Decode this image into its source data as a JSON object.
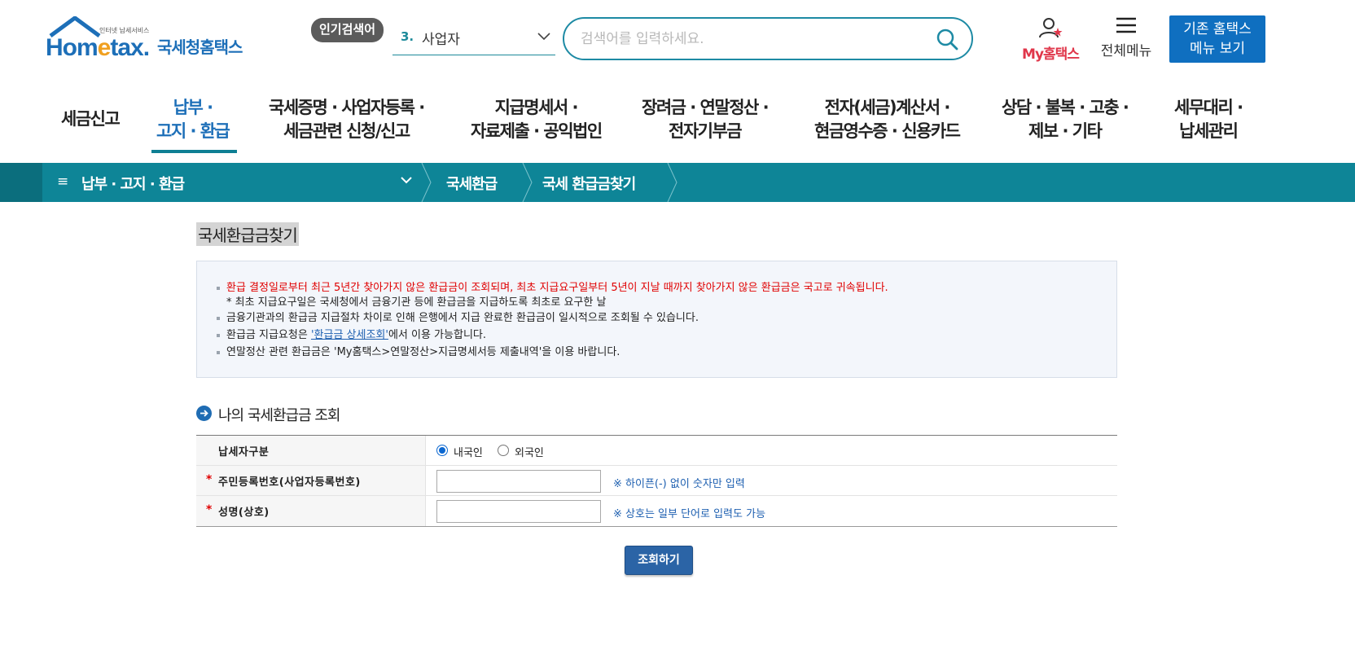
{
  "header": {
    "logo_tagline": "인터넷 납세서비스",
    "logo_brand_pre": "Hom",
    "logo_brand_e": "e",
    "logo_brand_post": "tax.",
    "logo_kr": "국세청홈택스",
    "popular_badge": "인기검색어",
    "popular_rank": "3.",
    "popular_word": "사업자",
    "search_placeholder": "검색어를 입력하세요.",
    "myhometax_label": "My홈택스",
    "allmenu_label": "전체메뉴",
    "legacy_line1": "기존 홈택스",
    "legacy_line2": "메뉴 보기"
  },
  "gnb": [
    {
      "line1": "세금신고",
      "line2": ""
    },
    {
      "line1": "납부 ·",
      "line2": "고지 · 환급"
    },
    {
      "line1": "국세증명 · 사업자등록 ·",
      "line2": "세금관련 신청/신고"
    },
    {
      "line1": "지급명세서 ·",
      "line2": "자료제출 · 공익법인"
    },
    {
      "line1": "장려금 · 연말정산 ·",
      "line2": "전자기부금"
    },
    {
      "line1": "전자(세금)계산서 ·",
      "line2": "현금영수증 · 신용카드"
    },
    {
      "line1": "상담 · 불복 · 고충 ·",
      "line2": "제보 · 기타"
    },
    {
      "line1": "세무대리 ·",
      "line2": "납세관리"
    }
  ],
  "breadcrumb": {
    "menu_icon": "≡",
    "menu_label": "납부 · 고지 · 환급",
    "crumb1": "국세환급",
    "crumb2": "국세 환급금찾기"
  },
  "page": {
    "title": "국세환급금찾기",
    "notice": {
      "line1": "환급 결정일로부터 최근 5년간 찾아가지 않은 환급금이 조회되며, 최초 지급요구일부터 5년이 지날 때까지 찾아가지 않은 환급금은 국고로 귀속됩니다.",
      "line1_sub": "* 최초 지급요구일은 국세청에서 금융기관 등에 환급금을 지급하도록 최초로 요구한 날",
      "line2": "금융기관과의 환급금 지급절차 차이로 인해 은행에서 지급 완료한 환급금이 일시적으로 조회될 수 있습니다.",
      "line3_pre": "환급금 지급요청은 ",
      "line3_link": "'환급금 상세조회'",
      "line3_post": "에서 이용 가능합니다.",
      "line4": "연말정산 관련 환급금은 'My홈택스>연말정산>지급명세서등 제출내역'을 이용 바랍니다."
    },
    "section_title": "나의 국세환급금 조회",
    "form": {
      "taxpayer_type_label": "납세자구분",
      "radio_domestic": "내국인",
      "radio_foreign": "외국인",
      "req_mark": "*",
      "id_label": "주민등록번호(사업자등록번호)",
      "id_value": "",
      "id_hint": "※ 하이픈(-) 없이 숫자만 입력",
      "name_label": "성명(상호)",
      "name_value": "",
      "name_hint": "※ 상호는 일부 단어로 입력도 가능"
    },
    "submit_label": "조회하기"
  },
  "colors": {
    "brand_blue": "#1d6fb8",
    "teal_bar": "#0e8597",
    "my_red": "#e0364a",
    "notice_red": "#e00000",
    "button_blue": "#2b64a6"
  }
}
